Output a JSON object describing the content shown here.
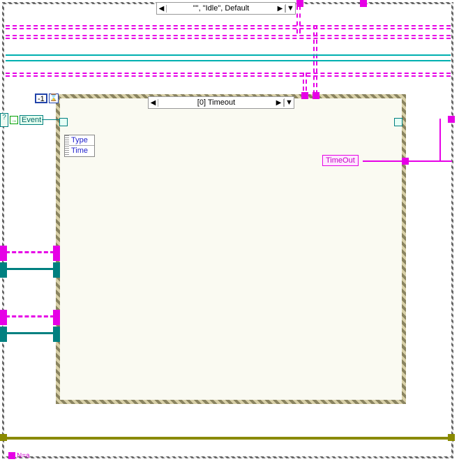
{
  "case_structure": {
    "selector_label": "\"\", \"Idle\", Default"
  },
  "event_structure": {
    "selector_label": "[0] Timeout",
    "timeout_input_value": "-1",
    "event_data_terms": [
      "Type",
      "Time"
    ]
  },
  "nodes": {
    "event_label": "Event",
    "timeout_constant": "TimeOut",
    "bottom_annotation": "N=a"
  },
  "icons": {
    "left_arrow": "◀",
    "right_arrow": "▶",
    "dropdown": "▼",
    "hourglass": "⌛",
    "conditional": "?",
    "in_arrow": "→"
  },
  "colors": {
    "magenta": "#e600e6",
    "teal": "#008080",
    "olive": "#8a8a00",
    "blue": "#2244aa"
  }
}
